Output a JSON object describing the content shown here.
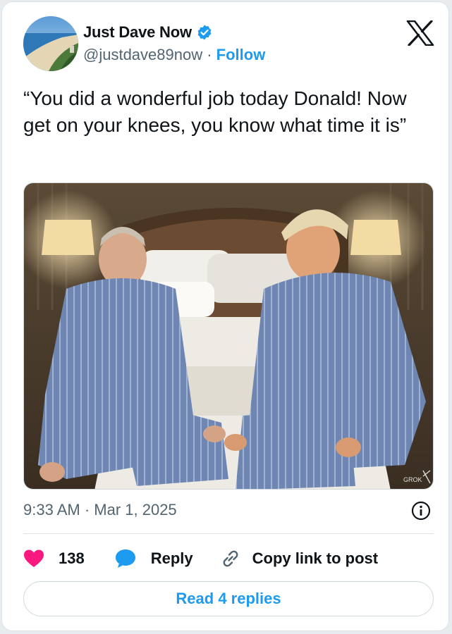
{
  "author": {
    "display_name": "Just Dave Now",
    "handle": "@justdave89now",
    "separator": " · ",
    "follow_label": "Follow",
    "verified_icon": "verified-badge-icon"
  },
  "brand_icon": "x-logo-icon",
  "tweet": {
    "text": "“You did a wonderful job today Donald! Now get on your knees, you know what time it is”",
    "media_watermark": "GROK",
    "timestamp": "9:33 AM · Mar 1, 2025"
  },
  "actions": {
    "like_count": "138",
    "reply_label": "Reply",
    "copy_link_label": "Copy link to post"
  },
  "read_replies_label": "Read 4 replies",
  "colors": {
    "accent": "#1d9bf0",
    "like": "#f91880",
    "text": "#0f1419",
    "muted": "#536471",
    "border": "#dfe3e7"
  }
}
